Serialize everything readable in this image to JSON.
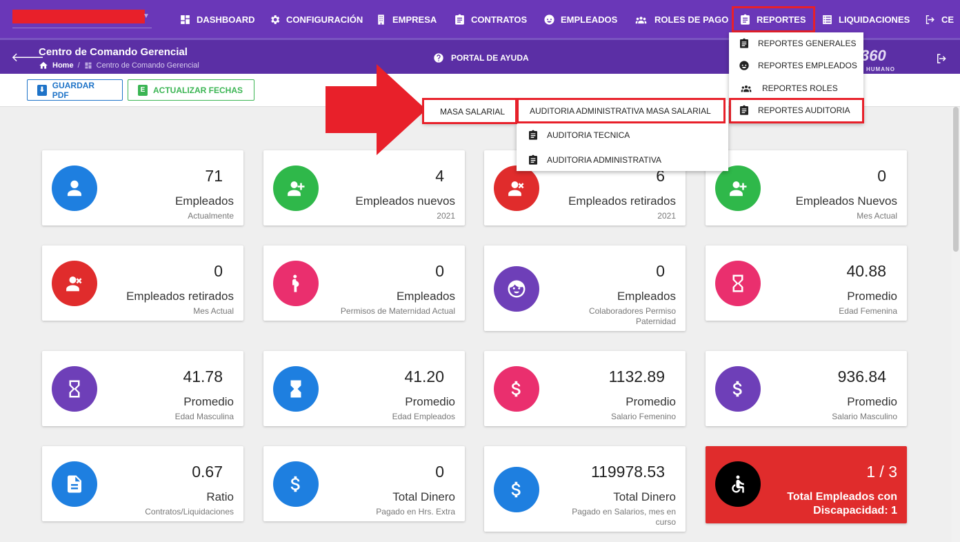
{
  "topnav": {
    "items": [
      {
        "label": "DASHBOARD",
        "icon": "dashboard-icon"
      },
      {
        "label": "CONFIGURACIÓN",
        "icon": "gear-icon"
      },
      {
        "label": "EMPRESA",
        "icon": "building-icon"
      },
      {
        "label": "CONTRATOS",
        "icon": "clipboard-icon"
      },
      {
        "label": "EMPLEADOS",
        "icon": "face-icon"
      },
      {
        "label": "ROLES DE PAGO",
        "icon": "group-icon"
      },
      {
        "label": "REPORTES",
        "icon": "clipboard-icon"
      },
      {
        "label": "LIQUIDACIONES",
        "icon": "list-icon"
      },
      {
        "label": "CE",
        "icon": "logout-icon"
      }
    ]
  },
  "header": {
    "title": "Centro de Comando Gerencial",
    "breadcrumb_home": "Home",
    "breadcrumb_current": "Centro de Comando Gerencial",
    "help": "PORTAL DE AYUDA",
    "logo_text": "360",
    "logo_sub": "HUMANO"
  },
  "actions": {
    "pdf": "GUARDAR PDF",
    "fechas": "ACTUALIZAR FECHAS"
  },
  "reportes_menu": [
    "REPORTES GENERALES",
    "REPORTES EMPLEADOS",
    "REPORTES ROLES",
    "REPORTES AUDITORIA"
  ],
  "auditoria_menu": [
    "AUDITORIA ADMINISTRATIVA MASA SALARIAL",
    "AUDITORIA TECNICA",
    "AUDITORIA ADMINISTRATIVA"
  ],
  "masa_salarial": "MASA SALARIAL",
  "cards": [
    {
      "value": "71",
      "label": "Empleados",
      "sub": "Actualmente",
      "color": "#1e7fe0",
      "icon": "person-icon"
    },
    {
      "value": "4",
      "label": "Empleados nuevos",
      "sub": "2021",
      "color": "#2fb84a",
      "icon": "person-add-icon"
    },
    {
      "value": "6",
      "label": "Empleados retirados",
      "sub": "2021",
      "color": "#e02c2c",
      "icon": "person-remove-icon"
    },
    {
      "value": "0",
      "label": "Empleados Nuevos",
      "sub": "Mes Actual",
      "color": "#2fb84a",
      "icon": "person-add-icon"
    },
    {
      "value": "0",
      "label": "Empleados retirados",
      "sub": "Mes Actual",
      "color": "#e02c2c",
      "icon": "person-remove-icon"
    },
    {
      "value": "0",
      "label": "Empleados",
      "sub": "Permisos de Maternidad Actual",
      "color": "#ea2f6e",
      "icon": "pregnant-icon"
    },
    {
      "value": "0",
      "label": "Empleados",
      "sub": "Colaboradores Permiso Paternidad",
      "color": "#6e3fb8",
      "icon": "child-face-icon"
    },
    {
      "value": "40.88",
      "label": "Promedio",
      "sub": "Edad Femenina",
      "color": "#ea2f6e",
      "icon": "hourglass-empty-icon"
    },
    {
      "value": "41.78",
      "label": "Promedio",
      "sub": "Edad Masculina",
      "color": "#6e3fb8",
      "icon": "hourglass-empty-icon"
    },
    {
      "value": "41.20",
      "label": "Promedio",
      "sub": "Edad Empleados",
      "color": "#1e7fe0",
      "icon": "hourglass-full-icon"
    },
    {
      "value": "1132.89",
      "label": "Promedio",
      "sub": "Salario Femenino",
      "color": "#ea2f6e",
      "icon": "dollar-icon"
    },
    {
      "value": "936.84",
      "label": "Promedio",
      "sub": "Salario Masculino",
      "color": "#6e3fb8",
      "icon": "dollar-icon"
    },
    {
      "value": "0.67",
      "label": "Ratio",
      "sub": "Contratos/Liquidaciones",
      "color": "#1e7fe0",
      "icon": "document-icon"
    },
    {
      "value": "0",
      "label": "Total Dinero",
      "sub": "Pagado en Hrs. Extra",
      "color": "#1e7fe0",
      "icon": "dollar-icon"
    },
    {
      "value": "119978.53",
      "label": "Total Dinero",
      "sub": "Pagado en Salarios, mes en curso",
      "color": "#1e7fe0",
      "icon": "dollar-icon"
    },
    {
      "value": "1 / 3",
      "label": "Total Empleados con Discapacidad: 1",
      "sub": "",
      "color": "#000000",
      "icon": "wheelchair-icon"
    }
  ],
  "colors": {
    "nav": "#6a37b8",
    "subnav": "#5b2fa5",
    "highlight": "#e8202a"
  }
}
